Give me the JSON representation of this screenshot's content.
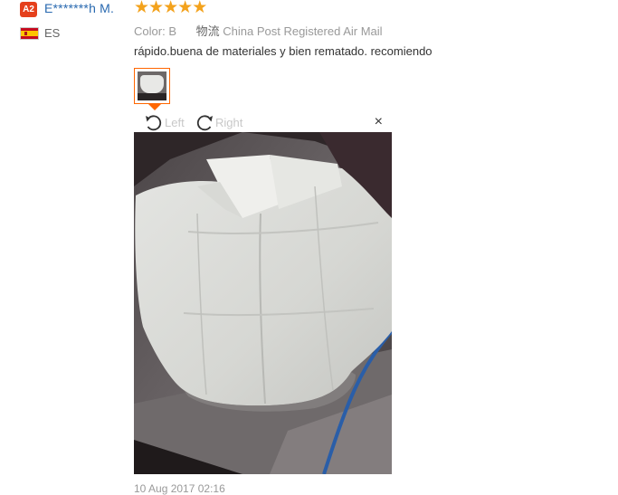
{
  "user": {
    "level_badge": "A2",
    "name": "E*******h M.",
    "country": "ES"
  },
  "review": {
    "rating": 5,
    "stars": [
      "★",
      "★",
      "★",
      "★",
      "★"
    ],
    "color_label": "Color:",
    "color_value": "B",
    "logistics_label": "物流",
    "logistics_value": "China Post Registered Air Mail",
    "text": "rápido.buena de materiales y bien rematado. recomiendo",
    "date": "10 Aug 2017 02:16"
  },
  "viewer": {
    "rotate_left_label": "Left",
    "rotate_right_label": "Right",
    "close_symbol": "×"
  },
  "colors": {
    "accent": "#ff6600",
    "star": "#f3a21c",
    "username": "#2969b0",
    "badge": "#e5401c"
  },
  "icons": [
    "rotate-left-icon",
    "rotate-right-icon",
    "close-icon",
    "star-icon",
    "spain-flag-icon"
  ]
}
